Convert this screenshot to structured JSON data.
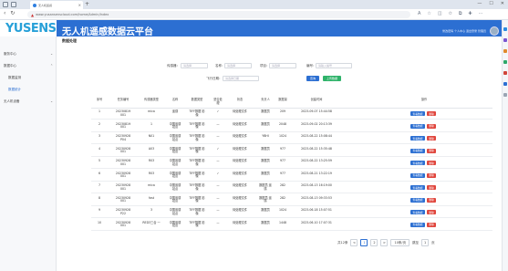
{
  "browser": {
    "tab_title": "无人机遥感",
    "url": "www.yusansenscloud.com/home/Admin/Index",
    "new_tab": "+",
    "window_controls": [
      "—",
      "☐",
      "✕"
    ]
  },
  "header": {
    "logo": "YUSENSE",
    "title": "无人机遥感数据云平台",
    "user_links": "修改密码  个人中心  退出登录  管理员"
  },
  "sidebar": {
    "items": [
      {
        "label": "服务中心",
        "arrow": "⌄"
      },
      {
        "label": "数据中心",
        "arrow": "⌃"
      },
      {
        "label": "数据监测",
        "arrow": ""
      },
      {
        "label": "数据统计",
        "arrow": ""
      },
      {
        "label": "无人机设备",
        "arrow": "⌄"
      }
    ]
  },
  "page": {
    "title": "数据处理",
    "filters": {
      "l1": "传感器：",
      "p1": "请选择",
      "l2": "名称：",
      "p2": "请选择",
      "l3": "项目：",
      "p3": "请选择",
      "l4": "编号：",
      "p4": "请输入编号",
      "l5": "飞行日期：",
      "p5": "请选择日期",
      "search": "查询",
      "reset": "上传数据"
    }
  },
  "table": {
    "headers": [
      "序号",
      "任务编号",
      "传感器类型",
      "名称",
      "数据类型",
      "是否处理",
      "状态",
      "负责人",
      "数据量",
      "创建时间",
      "操作"
    ],
    "rows": [
      {
        "no": "1",
        "id": "20230819 001",
        "sensor": "mica",
        "name": "遥感",
        "type": "TIFF数据 影像",
        "done": "✓",
        "status": "待处理文件",
        "owner": "数据员",
        "size": "209",
        "time": "2023-09-07 15:44:58"
      },
      {
        "no": "2",
        "id": "20230819 001",
        "sensor": "1",
        "name": "中国遥感 站点",
        "type": "TIFF数据 影像",
        "done": "—",
        "status": "待处理文件",
        "owner": "数据员",
        "size": "2048",
        "time": "2023-09-02 20:13:39"
      },
      {
        "no": "3",
        "id": "20230928 P04",
        "sensor": "N01",
        "name": "中国遥感 站点",
        "type": "TIFF数据 影像",
        "done": "—",
        "status": "待处理文件",
        "owner": "YBHI",
        "size": "1024",
        "time": "2023-08-22 15:08:44"
      },
      {
        "no": "4",
        "id": "20230928 001",
        "sensor": "A03",
        "name": "中国遥感 站点",
        "type": "TIFF数据 影像",
        "done": "✓",
        "status": "待处理文件",
        "owner": "数据员",
        "size": "977",
        "time": "2023-08-22 15:35:48"
      },
      {
        "no": "5",
        "id": "20230928 001",
        "sensor": "R03",
        "name": "中国遥感 站点",
        "type": "TIFF数据 影像",
        "done": "—",
        "status": "待处理文件",
        "owner": "数据员",
        "size": "977",
        "time": "2023-08-22 13:25:59"
      },
      {
        "no": "6",
        "id": "20230928 001",
        "sensor": "R03",
        "name": "中国遥感 站点",
        "type": "TIFF数据 影像",
        "done": "✓",
        "status": "待处理文件",
        "owner": "数据员",
        "size": "977",
        "time": "2023-08-21 13:22:19"
      },
      {
        "no": "7",
        "id": "20230928 001",
        "sensor": "mica",
        "name": "中国遥感 站点",
        "type": "TIFF数据 影像",
        "done": "—",
        "status": "待处理文件",
        "owner": "数据员 遥感",
        "size": "282",
        "time": "2023-08-13 16:19:00"
      },
      {
        "no": "8",
        "id": "20230928 001",
        "sensor": "fast",
        "name": "中国遥感 站点",
        "type": "TIFF数据 影像",
        "done": "—",
        "status": "待处理文件",
        "owner": "数据员 遥感",
        "size": "282",
        "time": "2023-08-13 09:33:53"
      },
      {
        "no": "9",
        "id": "20230928 P22",
        "sensor": "3",
        "name": "中国遥感 站点",
        "type": "TIFF数据 影像",
        "done": "—",
        "status": "待处理文件",
        "owner": "数据员",
        "size": "1024",
        "time": "2023-06-18 15:07:51"
      },
      {
        "no": "10",
        "id": "20230928 001",
        "sensor": "RED3三合 一",
        "name": "中国遥感 站点",
        "type": "TIFF数据 影像",
        "done": "—",
        "status": "待处理文件",
        "owner": "数据员",
        "size": "1448",
        "time": "2023-06-10 17:07:31"
      }
    ],
    "action_edit": "查看数据",
    "action_delete": "删除"
  },
  "pagination": {
    "total": "共12条",
    "prev": "<",
    "pages": [
      "1",
      "2"
    ],
    "next": ">",
    "size": "10条/页",
    "goto": "跳至",
    "goto_val": "1",
    "page_unit": "页",
    "colors": {
      "primary": "#2c6fd2",
      "danger": "#e0463d",
      "success": "#2fb36a",
      "logo": "#27a0d8"
    }
  }
}
